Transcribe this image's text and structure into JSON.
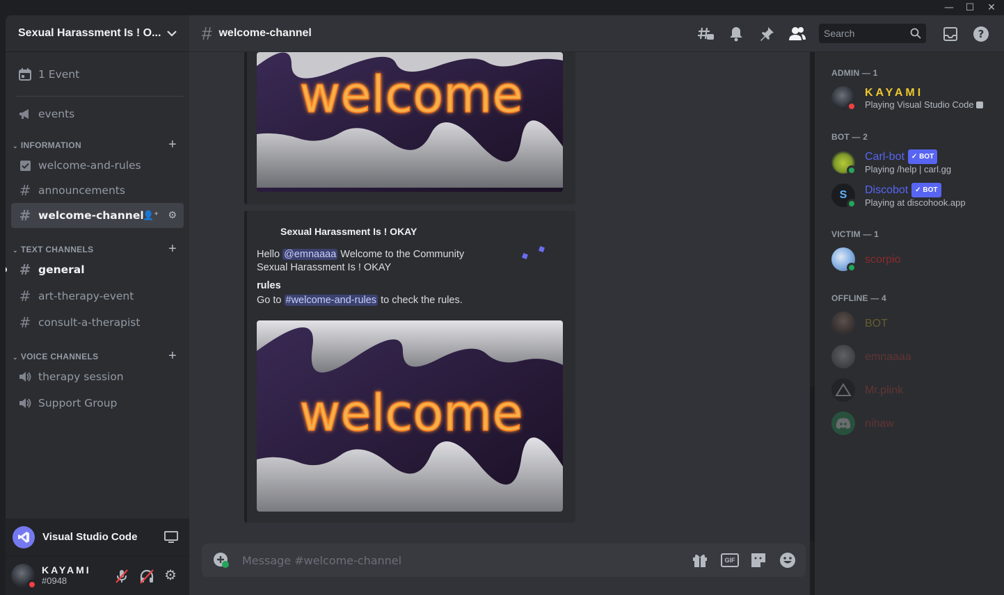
{
  "window": {
    "minimize": "—",
    "maximize": "☐",
    "close": "✕"
  },
  "server": {
    "name": "Sexual Harassment Is ! O...",
    "events_label": "1 Event"
  },
  "channels": {
    "top": [
      {
        "label": "events",
        "icon": "megaphone-icon"
      }
    ],
    "information": {
      "title": "INFORMATION",
      "items": [
        {
          "label": "welcome-and-rules",
          "icon": "checkbox-icon"
        },
        {
          "label": "announcements",
          "icon": "hash-icon"
        },
        {
          "label": "welcome-channel",
          "icon": "hash-icon"
        }
      ]
    },
    "text": {
      "title": "TEXT CHANNELS",
      "items": [
        {
          "label": "general",
          "icon": "hash-icon"
        },
        {
          "label": "art-therapy-event",
          "icon": "hash-icon"
        },
        {
          "label": "consult-a-therapist",
          "icon": "hash-icon"
        }
      ]
    },
    "voice": {
      "title": "VOICE CHANNELS",
      "items": [
        {
          "label": "therapy session",
          "icon": "speaker-icon"
        },
        {
          "label": "Support Group",
          "icon": "speaker-icon"
        }
      ]
    }
  },
  "activity": {
    "label": "Visual Studio Code"
  },
  "user": {
    "name": "KAYAMI",
    "tag": "#0948"
  },
  "header": {
    "channel": "welcome-channel",
    "search_placeholder": "Search"
  },
  "embed": {
    "author": "Sexual Harassment Is ! OKAY",
    "hello": "Hello",
    "mention": "@emnaaaa",
    "welcome_line": "Welcome to the Community",
    "welcome_line2": "Sexual Harassment Is ! OKAY",
    "field_title": "rules",
    "goto": "Go to",
    "channel_mention": "#welcome-and-rules",
    "goto_after": "to check the rules.",
    "image_text": "welcome"
  },
  "composer": {
    "placeholder": "Message #welcome-channel"
  },
  "members": {
    "admin": {
      "title": "ADMIN — 1",
      "items": [
        {
          "name": "KAYAMI",
          "activity": "Playing Visual Studio Code",
          "color": "#f0c72d"
        }
      ]
    },
    "bot": {
      "title": "BOT — 2",
      "items": [
        {
          "name": "Carl-bot",
          "activity": "Playing /help | carl.gg",
          "badge": "✓ BOT",
          "color": "#5865f2"
        },
        {
          "name": "Discobot",
          "activity": "Playing at discohook.app",
          "badge": "✓ BOT",
          "color": "#5865f2"
        }
      ]
    },
    "victim": {
      "title": "VICTIM — 1",
      "items": [
        {
          "name": "scorpio",
          "color": "#8b2a2a"
        }
      ]
    },
    "offline": {
      "title": "OFFLINE — 4",
      "items": [
        {
          "name": "BOT",
          "color": "#f0c72d"
        },
        {
          "name": "emnaaaa",
          "color": "#e0443c"
        },
        {
          "name": "Mr.plink",
          "color": "#e0443c"
        },
        {
          "name": "nihaw",
          "color": "#e0443c"
        }
      ]
    }
  },
  "colors": {
    "accent": "#5865f2",
    "admin": "#f0c72d",
    "online": "#23a55a",
    "dnd": "#f23f43"
  }
}
